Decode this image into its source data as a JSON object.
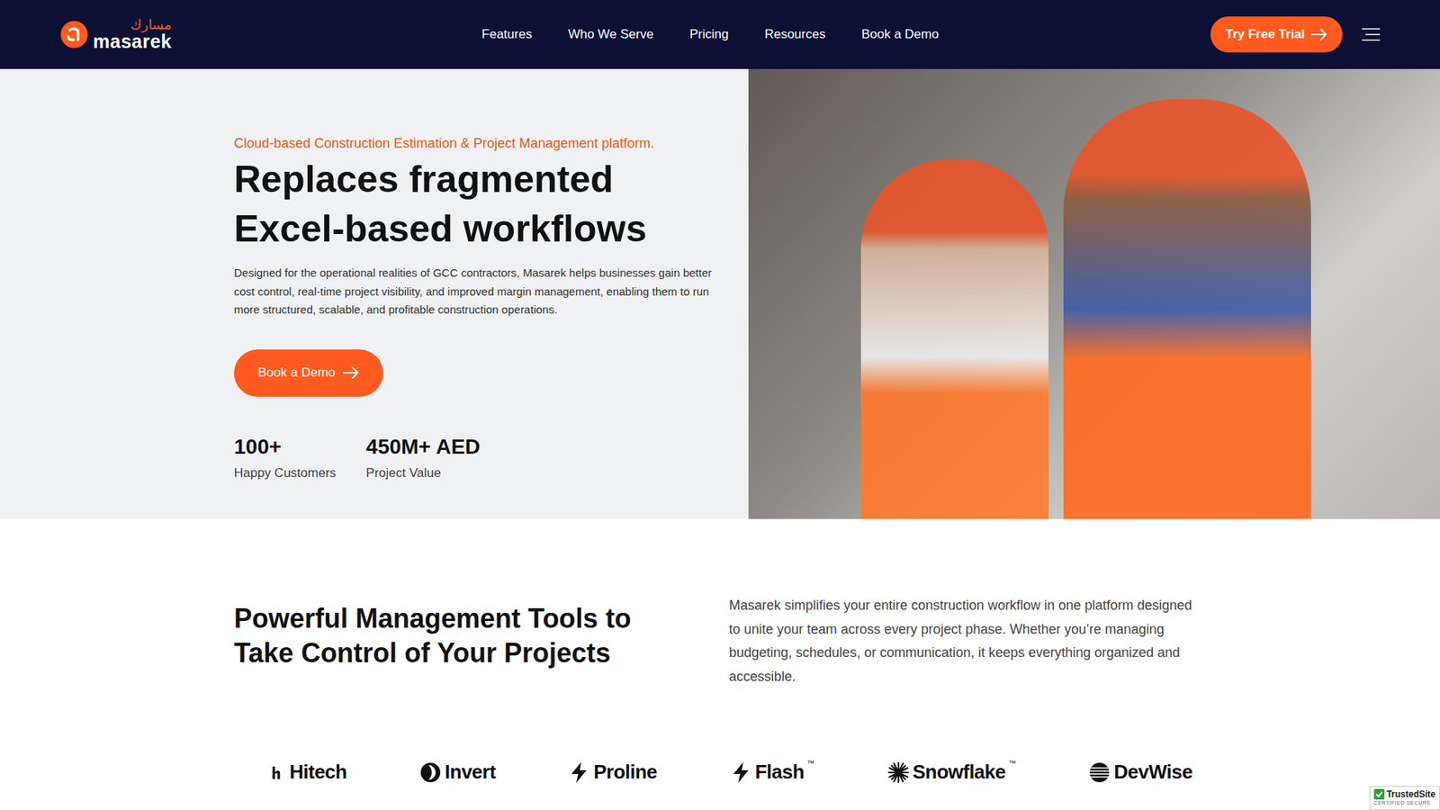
{
  "brand": {
    "arabic": "مسارك",
    "name": "masarek"
  },
  "nav": {
    "links": [
      {
        "label": "Features"
      },
      {
        "label": "Who We Serve"
      },
      {
        "label": "Pricing"
      },
      {
        "label": "Resources"
      },
      {
        "label": "Book a Demo"
      }
    ],
    "cta": "Try Free Trial"
  },
  "hero": {
    "eyebrow": "Cloud-based Construction Estimation & Project Management platform.",
    "title_lines": [
      "Replaces fragmented",
      "Excel-based workflows"
    ],
    "description": "Designed for the operational realities of GCC contractors, Masarek helps businesses gain better cost control, real-time project visibility, and improved margin management, enabling them to run more structured, scalable, and profitable construction operations.",
    "button": "Book a Demo",
    "stats": [
      {
        "value": "100+",
        "label": "Happy Customers"
      },
      {
        "value": "450M+ AED",
        "label": "Project Value"
      }
    ]
  },
  "tools": {
    "title_lines": [
      "Powerful Management Tools to",
      "Take Control of Your Projects"
    ],
    "description": "Masarek simplifies your entire construction workflow in one platform designed to unite your team across every project phase. Whether you’re managing budgeting, schedules, or communication, it keeps everything organized and accessible."
  },
  "logos": [
    {
      "name": "Hitech",
      "kind": "h"
    },
    {
      "name": "Invert",
      "kind": "circle"
    },
    {
      "name": "Proline",
      "kind": "bolt"
    },
    {
      "name": "Flash",
      "kind": "bolt",
      "trademark": "™"
    },
    {
      "name": "Snowflake",
      "kind": "snowflake",
      "trademark": "™"
    },
    {
      "name": "DevWise",
      "kind": "lines"
    }
  ],
  "badge": {
    "title": "TrustedSite",
    "subtitle": "CERTIFIED SECURE"
  }
}
